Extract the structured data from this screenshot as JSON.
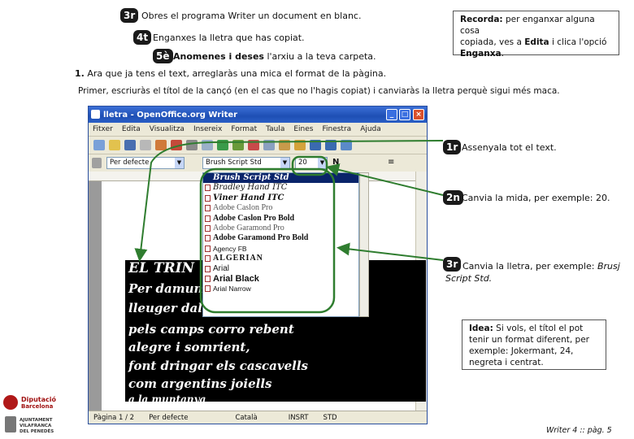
{
  "steps": {
    "s3": {
      "badge": "3r",
      "text": "Obres el programa Writer un document en blanc."
    },
    "s4": {
      "badge": "4t",
      "text": "Enganxes la lletra que has copiat."
    },
    "s5": {
      "badge": "5è",
      "bold": "Anomenes i deses",
      "text": " l'arxiu a la teva carpeta."
    }
  },
  "reminder": {
    "label": "Recorda:",
    "line1": " per enganxar alguna cosa",
    "line2": "copiada, ves a ",
    "edita": "Edita",
    "line2b": " i clica l'opció",
    "enganxa": "Enganxa",
    "dot": "."
  },
  "intro": {
    "num": "1.",
    "line1": " Ara que ja tens el text, arreglaràs una mica el format de la pàgina.",
    "line2": "Primer, escriuràs el títol de la cançó (en el cas que no l'hagis copiat) i canviaràs la lletra perquè sigui més maca."
  },
  "window": {
    "title": "lletra - OpenOffice.org Writer",
    "menu": [
      "Fitxer",
      "Edita",
      "Visualitza",
      "Insereix",
      "Format",
      "Taula",
      "Eines",
      "Finestra",
      "Ajuda"
    ],
    "style_value": "Per defecte",
    "font_value": "Brush Script Std",
    "size_value": "20",
    "status": [
      "Pàgina 1 / 2",
      "Per defecte",
      "Català",
      "INSRT",
      "STD"
    ]
  },
  "font_list": [
    "Brush Script Std",
    "Bradley Hand ITC",
    "Viner Hand ITC",
    "Adobe Caslon Pro",
    "Adobe Caslon Pro Bold",
    "Adobe Garamond Pro",
    "Adobe Garamond Pro Bold",
    "Agency FB",
    "ALGERIAN",
    "Arial",
    "Arial Black",
    "Arial Narrow"
  ],
  "doc_lines": [
    "EL TRIN",
    "Per damunt",
    "lleuger dalt",
    "pels camps corro rebent",
    "alegre i somrient,",
    "font dringar els cascavells",
    "com argentins joiells",
    "a la muntanya"
  ],
  "callouts": {
    "c1": {
      "badge": "1r",
      "text": "Assenyala tot el text."
    },
    "c2": {
      "badge": "2n",
      "text": "Canvia la mida, per exemple: 20."
    },
    "c3": {
      "badge": "3r",
      "text": "Canvia la lletra, per exemple: ",
      "example": "Brusj",
      "line2": "Script Std."
    }
  },
  "idea": {
    "label": "Idea:",
    "line1": " Si vols, el títol el pot",
    "line2": "tenir un format diferent, per",
    "line3": "exemple: Jokermant, 24,",
    "line4": "negreta i centrat."
  },
  "footer": {
    "diputacio": "Diputació",
    "barcelona": "Barcelona",
    "ajuntament1": "AJUNTAMENT",
    "ajuntament2": "VILAFRANCA",
    "ajuntament3": "DEL PENEDÈS",
    "page": "Writer 4 :: pàg. 5"
  },
  "colors": {
    "arrow_green": "#2f7d2f",
    "badge_bg": "#1a1a1a",
    "title_blue": "#1e4fb4"
  }
}
